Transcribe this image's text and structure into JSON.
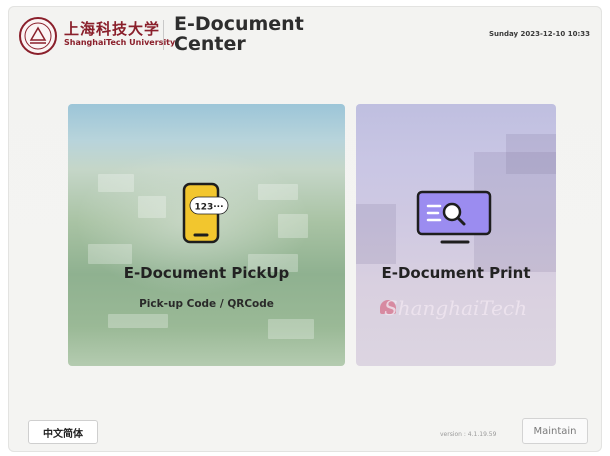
{
  "header": {
    "university_cn": "上海科技大学",
    "university_en": "ShanghaiTech University",
    "app_title": "E-Document Center",
    "datetime": "Sunday 2023-12-10 10:33"
  },
  "cards": [
    {
      "title": "E-Document PickUp",
      "subtitle": "Pick-up Code / QRCode",
      "icon": "phone-code-icon",
      "icon_text": "123···"
    },
    {
      "title": "E-Document Print",
      "icon": "monitor-search-icon",
      "background_sign": "ShanghaiTech"
    }
  ],
  "footer": {
    "language_button": "中文简体",
    "version": "version : 4.1.19.59",
    "maintain_button": "Maintain"
  },
  "colors": {
    "brand": "#8a1f2b",
    "phone_icon": "#f2c62e",
    "monitor_icon": "#9b8cf0"
  }
}
